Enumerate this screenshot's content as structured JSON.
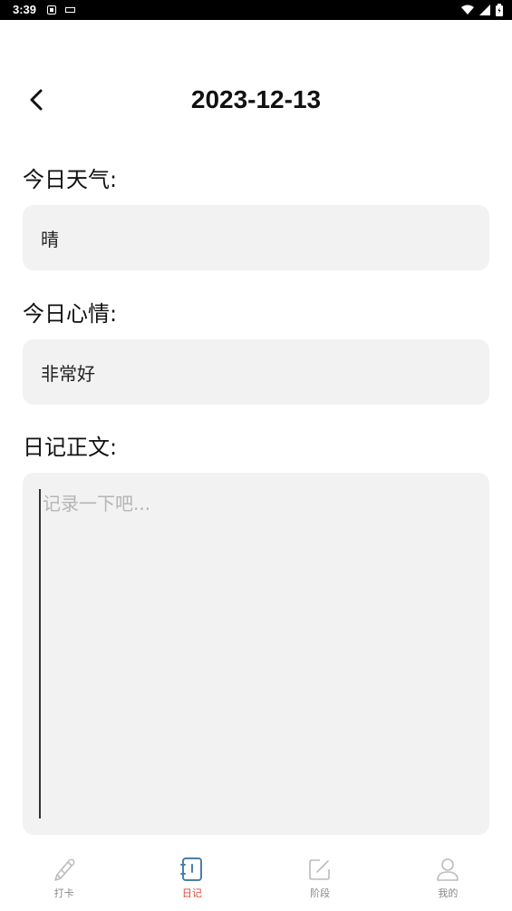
{
  "status_bar": {
    "time": "3:39"
  },
  "header": {
    "title": "2023-12-13",
    "back_icon": "chevron-left-icon"
  },
  "weather": {
    "label": "今日天气:",
    "value": "晴"
  },
  "mood": {
    "label": "今日心情:",
    "value": "非常好"
  },
  "diary": {
    "label": "日记正文:",
    "placeholder": "记录一下吧..."
  },
  "bottom_nav": {
    "items": [
      {
        "label": "打卡",
        "icon": "pen-icon",
        "active": false
      },
      {
        "label": "日记",
        "icon": "notebook-icon",
        "active": true
      },
      {
        "label": "阶段",
        "icon": "edit-icon",
        "active": false
      },
      {
        "label": "我的",
        "icon": "user-icon",
        "active": false
      }
    ]
  },
  "colors": {
    "accent": "#e0473b",
    "active_icon": "#4a7fa8",
    "inactive": "#bbbbbb",
    "field_bg": "#f2f2f2"
  }
}
